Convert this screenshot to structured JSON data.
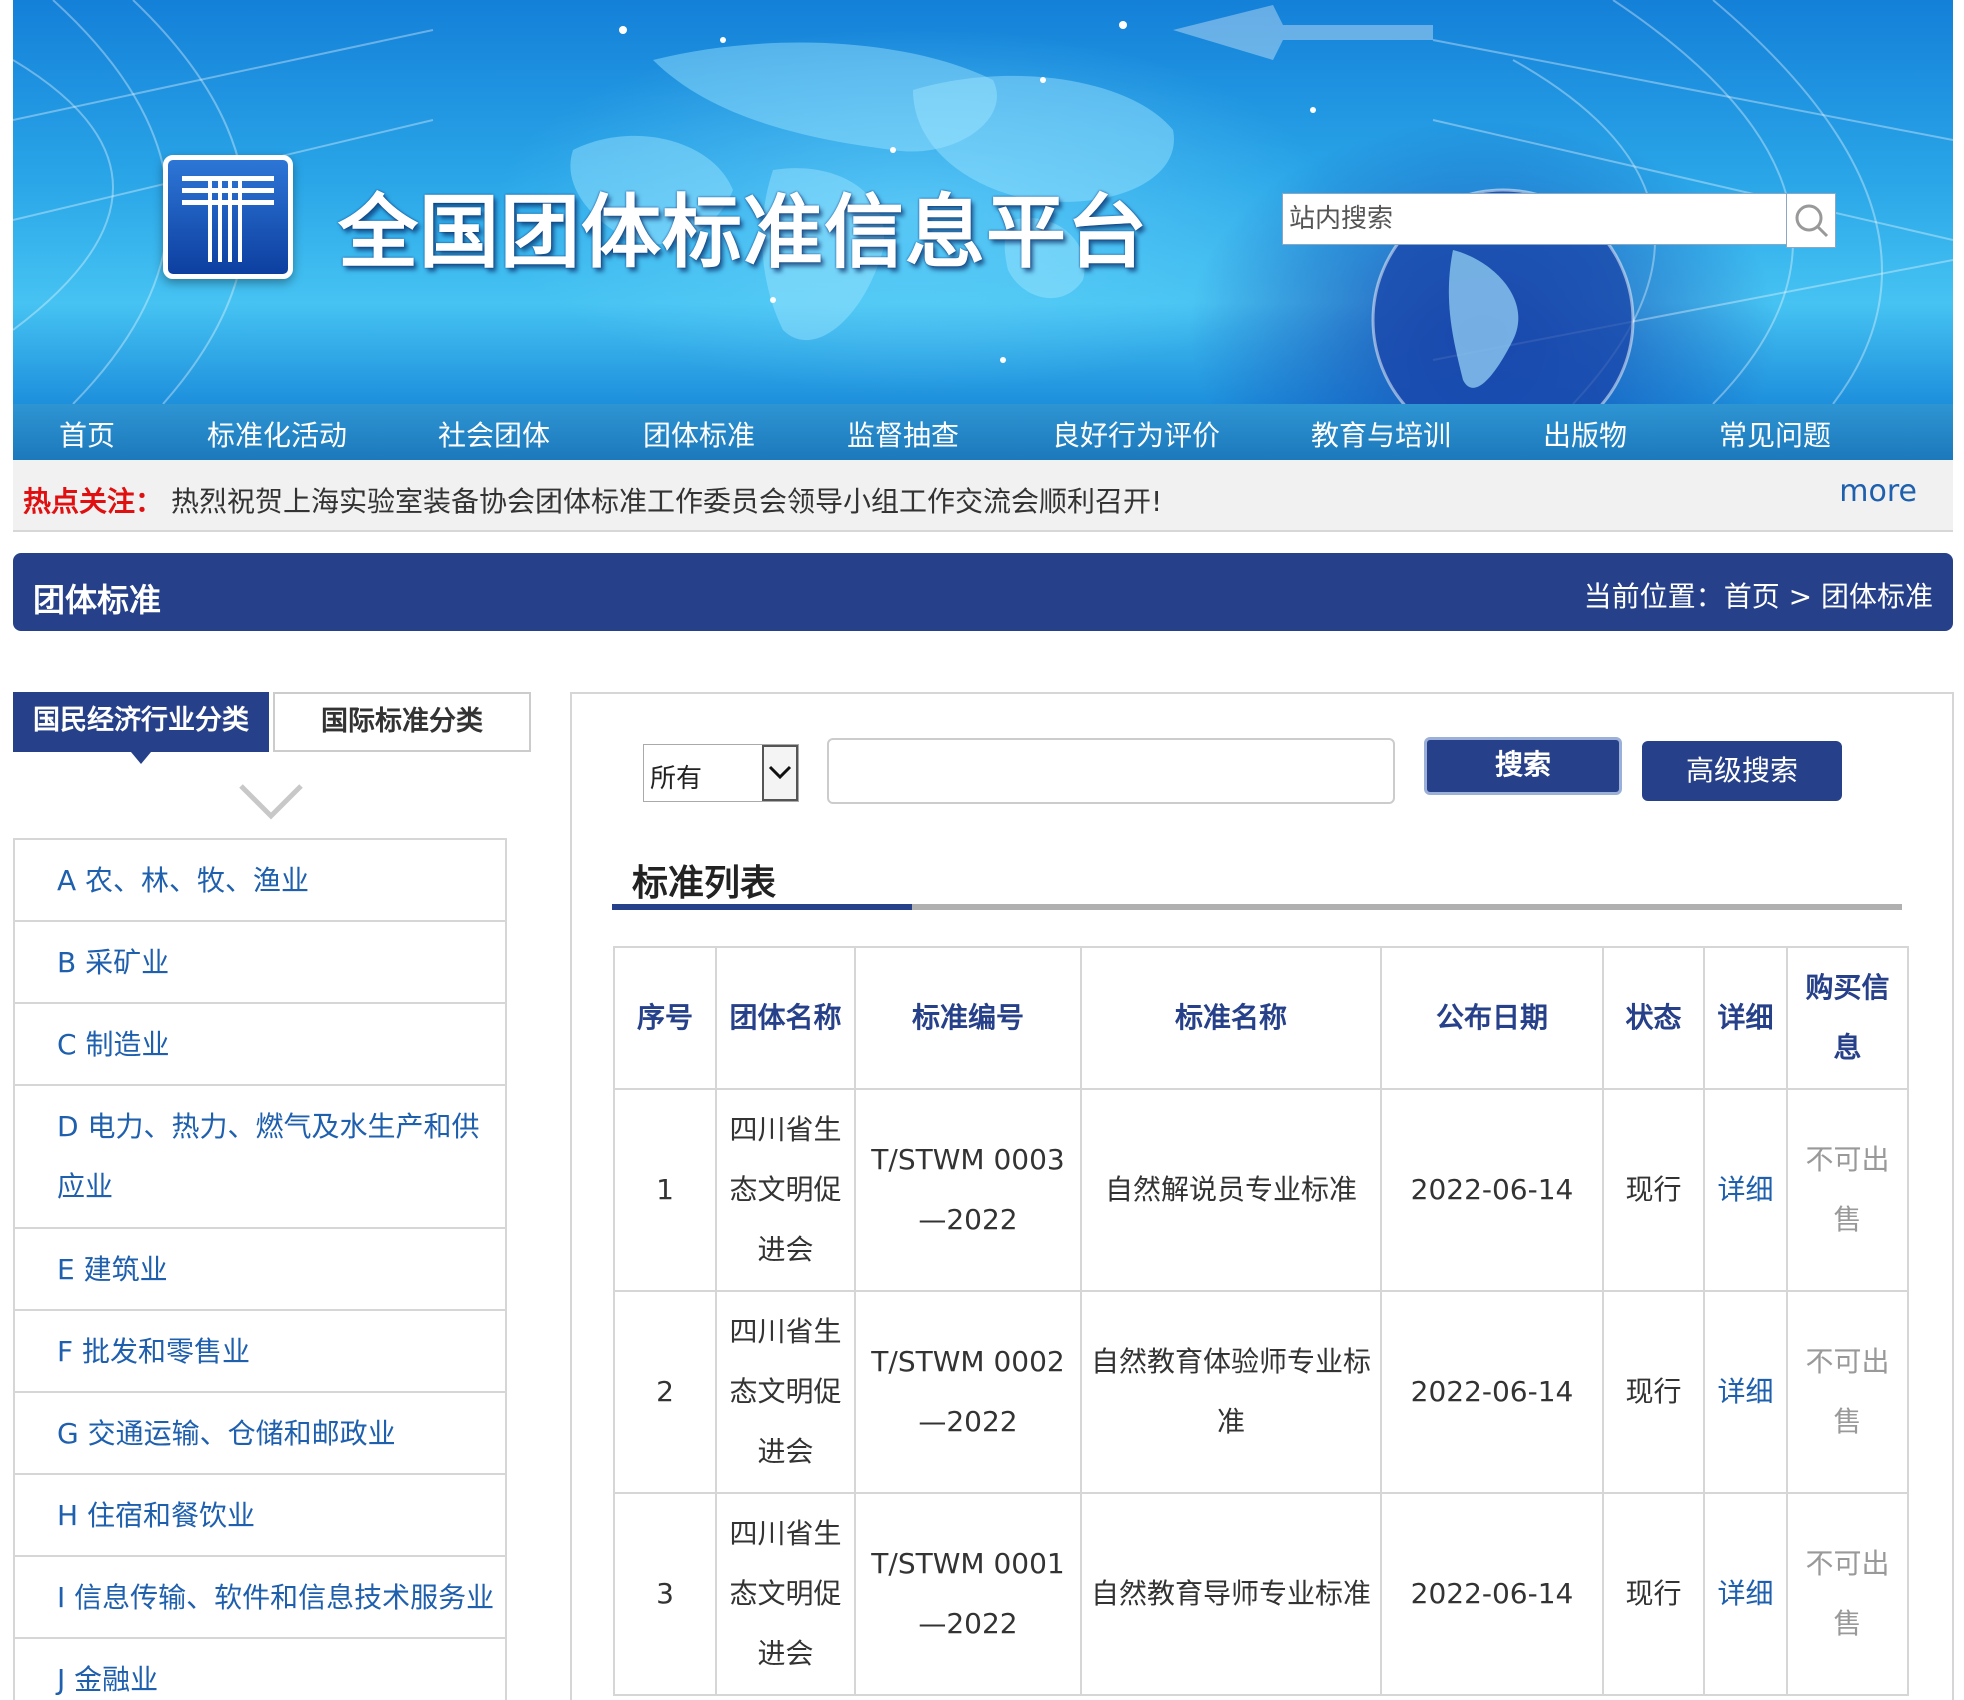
{
  "site": {
    "title": "全国团体标准信息平台",
    "search_placeholder": "站内搜索"
  },
  "nav": {
    "items": [
      "首页",
      "标准化活动",
      "社会团体",
      "团体标准",
      "监督抽查",
      "良好行为评价",
      "教育与培训",
      "出版物",
      "常见问题"
    ]
  },
  "hot": {
    "label": "热点关注：",
    "text": "热烈祝贺上海实验室装备协会团体标准工作委员会领导小组工作交流会顺利召开!",
    "more": "more"
  },
  "titlebar": {
    "title": "团体标准",
    "crumb_prefix": "当前位置：",
    "crumb_home": "首页",
    "crumb_sep": ">",
    "crumb_current": "团体标准"
  },
  "sidebar": {
    "tab_active": "国民经济行业分类",
    "tab_inactive": "国际标准分类",
    "categories": [
      "A 农、林、牧、渔业",
      "B 采矿业",
      "C 制造业",
      "D 电力、热力、燃气及水生产和供应业",
      "E 建筑业",
      "F 批发和零售业",
      "G 交通运输、仓储和邮政业",
      "H 住宿和餐饮业",
      "I 信息传输、软件和信息技术服务业",
      "J 金融业"
    ]
  },
  "search": {
    "select_value": "所有",
    "keyword_value": "",
    "search_label": "搜索",
    "advanced_label": "高级搜索"
  },
  "list": {
    "title": "标准列表",
    "headers": [
      "序号",
      "团体名称",
      "标准编号",
      "标准名称",
      "公布日期",
      "状态",
      "详细",
      "购买信息"
    ],
    "rows": [
      {
        "no": "1",
        "org": "四川省生态文明促进会",
        "code": "T/STWM 0003—2022",
        "name": "自然解说员专业标准",
        "date": "2022-06-14",
        "status": "现行",
        "detail": "详细",
        "buy": "不可出售"
      },
      {
        "no": "2",
        "org": "四川省生态文明促进会",
        "code": "T/STWM 0002—2022",
        "name": "自然教育体验师专业标准",
        "date": "2022-06-14",
        "status": "现行",
        "detail": "详细",
        "buy": "不可出售"
      },
      {
        "no": "3",
        "org": "四川省生态文明促进会",
        "code": "T/STWM 0001—2022",
        "name": "自然教育导师专业标准",
        "date": "2022-06-14",
        "status": "现行",
        "detail": "详细",
        "buy": "不可出售"
      }
    ]
  }
}
